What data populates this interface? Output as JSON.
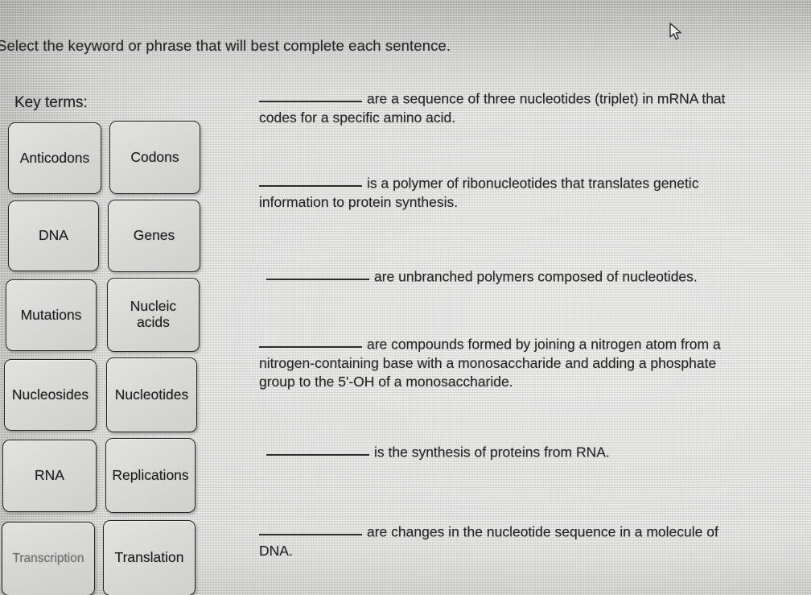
{
  "prompt": "Select the keyword or phrase that will best complete each sentence.",
  "key_terms": {
    "label": "Key terms:",
    "tiles": [
      {
        "label": "Anticodons",
        "state": "normal"
      },
      {
        "label": "Codons",
        "state": "normal"
      },
      {
        "label": "DNA",
        "state": "normal"
      },
      {
        "label": "Genes",
        "state": "normal"
      },
      {
        "label": "Mutations",
        "state": "normal"
      },
      {
        "label": "Nucleic acids",
        "state": "normal"
      },
      {
        "label": "Nucleosides",
        "state": "normal"
      },
      {
        "label": "Nucleotides",
        "state": "normal"
      },
      {
        "label": "RNA",
        "state": "normal"
      },
      {
        "label": "Replications",
        "state": "normal"
      },
      {
        "label": "Transcription",
        "state": "faded"
      },
      {
        "label": "Translation",
        "state": "normal"
      }
    ]
  },
  "sentences": [
    {
      "blank_label": "blank-1",
      "text": "are a sequence of three nucleotides (triplet) in mRNA that codes for a specific amino acid."
    },
    {
      "blank_label": "blank-2",
      "text": "is a polymer of ribonucleotides that translates genetic information to protein synthesis."
    },
    {
      "blank_label": "blank-3",
      "text": "are unbranched polymers composed of nucleotides."
    },
    {
      "blank_label": "blank-4",
      "text": "are compounds formed by joining a nitrogen atom from a nitrogen-containing base with a monosaccharide and adding a phosphate group to the 5'-OH of a monosaccharide."
    },
    {
      "blank_label": "blank-5",
      "text": "is the synthesis of proteins from RNA."
    },
    {
      "blank_label": "blank-6",
      "text": "are changes in the nucleotide sequence in a molecule of DNA."
    }
  ],
  "cursor": {
    "icon": "arrow-pointer"
  },
  "colors": {
    "background": "#dededc",
    "tile_face": "#d9d9d7",
    "tile_border": "#242424",
    "text": "#262626",
    "faded_text": "#6f6f6f"
  }
}
